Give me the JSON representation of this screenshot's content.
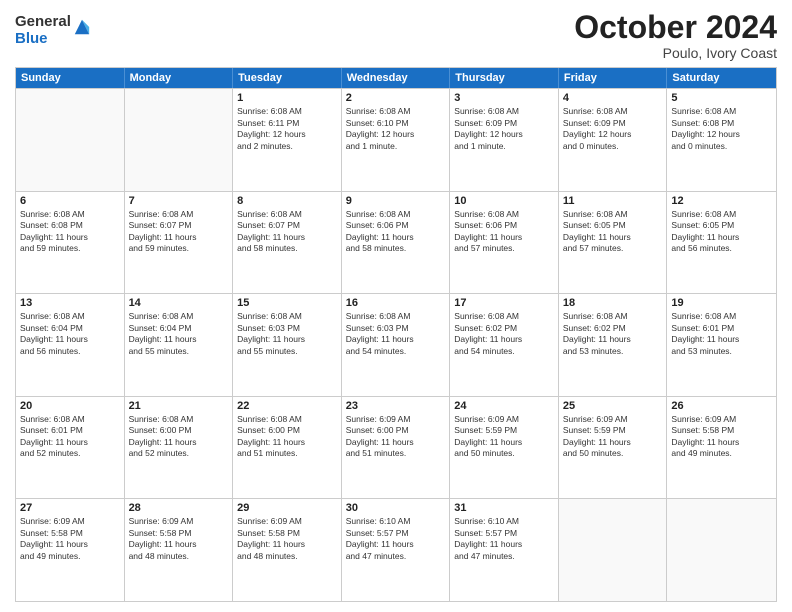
{
  "logo": {
    "general": "General",
    "blue": "Blue"
  },
  "header": {
    "month": "October 2024",
    "location": "Poulo, Ivory Coast"
  },
  "weekdays": [
    "Sunday",
    "Monday",
    "Tuesday",
    "Wednesday",
    "Thursday",
    "Friday",
    "Saturday"
  ],
  "weeks": [
    [
      {
        "day": "",
        "lines": []
      },
      {
        "day": "",
        "lines": []
      },
      {
        "day": "1",
        "lines": [
          "Sunrise: 6:08 AM",
          "Sunset: 6:11 PM",
          "Daylight: 12 hours",
          "and 2 minutes."
        ]
      },
      {
        "day": "2",
        "lines": [
          "Sunrise: 6:08 AM",
          "Sunset: 6:10 PM",
          "Daylight: 12 hours",
          "and 1 minute."
        ]
      },
      {
        "day": "3",
        "lines": [
          "Sunrise: 6:08 AM",
          "Sunset: 6:09 PM",
          "Daylight: 12 hours",
          "and 1 minute."
        ]
      },
      {
        "day": "4",
        "lines": [
          "Sunrise: 6:08 AM",
          "Sunset: 6:09 PM",
          "Daylight: 12 hours",
          "and 0 minutes."
        ]
      },
      {
        "day": "5",
        "lines": [
          "Sunrise: 6:08 AM",
          "Sunset: 6:08 PM",
          "Daylight: 12 hours",
          "and 0 minutes."
        ]
      }
    ],
    [
      {
        "day": "6",
        "lines": [
          "Sunrise: 6:08 AM",
          "Sunset: 6:08 PM",
          "Daylight: 11 hours",
          "and 59 minutes."
        ]
      },
      {
        "day": "7",
        "lines": [
          "Sunrise: 6:08 AM",
          "Sunset: 6:07 PM",
          "Daylight: 11 hours",
          "and 59 minutes."
        ]
      },
      {
        "day": "8",
        "lines": [
          "Sunrise: 6:08 AM",
          "Sunset: 6:07 PM",
          "Daylight: 11 hours",
          "and 58 minutes."
        ]
      },
      {
        "day": "9",
        "lines": [
          "Sunrise: 6:08 AM",
          "Sunset: 6:06 PM",
          "Daylight: 11 hours",
          "and 58 minutes."
        ]
      },
      {
        "day": "10",
        "lines": [
          "Sunrise: 6:08 AM",
          "Sunset: 6:06 PM",
          "Daylight: 11 hours",
          "and 57 minutes."
        ]
      },
      {
        "day": "11",
        "lines": [
          "Sunrise: 6:08 AM",
          "Sunset: 6:05 PM",
          "Daylight: 11 hours",
          "and 57 minutes."
        ]
      },
      {
        "day": "12",
        "lines": [
          "Sunrise: 6:08 AM",
          "Sunset: 6:05 PM",
          "Daylight: 11 hours",
          "and 56 minutes."
        ]
      }
    ],
    [
      {
        "day": "13",
        "lines": [
          "Sunrise: 6:08 AM",
          "Sunset: 6:04 PM",
          "Daylight: 11 hours",
          "and 56 minutes."
        ]
      },
      {
        "day": "14",
        "lines": [
          "Sunrise: 6:08 AM",
          "Sunset: 6:04 PM",
          "Daylight: 11 hours",
          "and 55 minutes."
        ]
      },
      {
        "day": "15",
        "lines": [
          "Sunrise: 6:08 AM",
          "Sunset: 6:03 PM",
          "Daylight: 11 hours",
          "and 55 minutes."
        ]
      },
      {
        "day": "16",
        "lines": [
          "Sunrise: 6:08 AM",
          "Sunset: 6:03 PM",
          "Daylight: 11 hours",
          "and 54 minutes."
        ]
      },
      {
        "day": "17",
        "lines": [
          "Sunrise: 6:08 AM",
          "Sunset: 6:02 PM",
          "Daylight: 11 hours",
          "and 54 minutes."
        ]
      },
      {
        "day": "18",
        "lines": [
          "Sunrise: 6:08 AM",
          "Sunset: 6:02 PM",
          "Daylight: 11 hours",
          "and 53 minutes."
        ]
      },
      {
        "day": "19",
        "lines": [
          "Sunrise: 6:08 AM",
          "Sunset: 6:01 PM",
          "Daylight: 11 hours",
          "and 53 minutes."
        ]
      }
    ],
    [
      {
        "day": "20",
        "lines": [
          "Sunrise: 6:08 AM",
          "Sunset: 6:01 PM",
          "Daylight: 11 hours",
          "and 52 minutes."
        ]
      },
      {
        "day": "21",
        "lines": [
          "Sunrise: 6:08 AM",
          "Sunset: 6:00 PM",
          "Daylight: 11 hours",
          "and 52 minutes."
        ]
      },
      {
        "day": "22",
        "lines": [
          "Sunrise: 6:08 AM",
          "Sunset: 6:00 PM",
          "Daylight: 11 hours",
          "and 51 minutes."
        ]
      },
      {
        "day": "23",
        "lines": [
          "Sunrise: 6:09 AM",
          "Sunset: 6:00 PM",
          "Daylight: 11 hours",
          "and 51 minutes."
        ]
      },
      {
        "day": "24",
        "lines": [
          "Sunrise: 6:09 AM",
          "Sunset: 5:59 PM",
          "Daylight: 11 hours",
          "and 50 minutes."
        ]
      },
      {
        "day": "25",
        "lines": [
          "Sunrise: 6:09 AM",
          "Sunset: 5:59 PM",
          "Daylight: 11 hours",
          "and 50 minutes."
        ]
      },
      {
        "day": "26",
        "lines": [
          "Sunrise: 6:09 AM",
          "Sunset: 5:58 PM",
          "Daylight: 11 hours",
          "and 49 minutes."
        ]
      }
    ],
    [
      {
        "day": "27",
        "lines": [
          "Sunrise: 6:09 AM",
          "Sunset: 5:58 PM",
          "Daylight: 11 hours",
          "and 49 minutes."
        ]
      },
      {
        "day": "28",
        "lines": [
          "Sunrise: 6:09 AM",
          "Sunset: 5:58 PM",
          "Daylight: 11 hours",
          "and 48 minutes."
        ]
      },
      {
        "day": "29",
        "lines": [
          "Sunrise: 6:09 AM",
          "Sunset: 5:58 PM",
          "Daylight: 11 hours",
          "and 48 minutes."
        ]
      },
      {
        "day": "30",
        "lines": [
          "Sunrise: 6:10 AM",
          "Sunset: 5:57 PM",
          "Daylight: 11 hours",
          "and 47 minutes."
        ]
      },
      {
        "day": "31",
        "lines": [
          "Sunrise: 6:10 AM",
          "Sunset: 5:57 PM",
          "Daylight: 11 hours",
          "and 47 minutes."
        ]
      },
      {
        "day": "",
        "lines": []
      },
      {
        "day": "",
        "lines": []
      }
    ]
  ]
}
